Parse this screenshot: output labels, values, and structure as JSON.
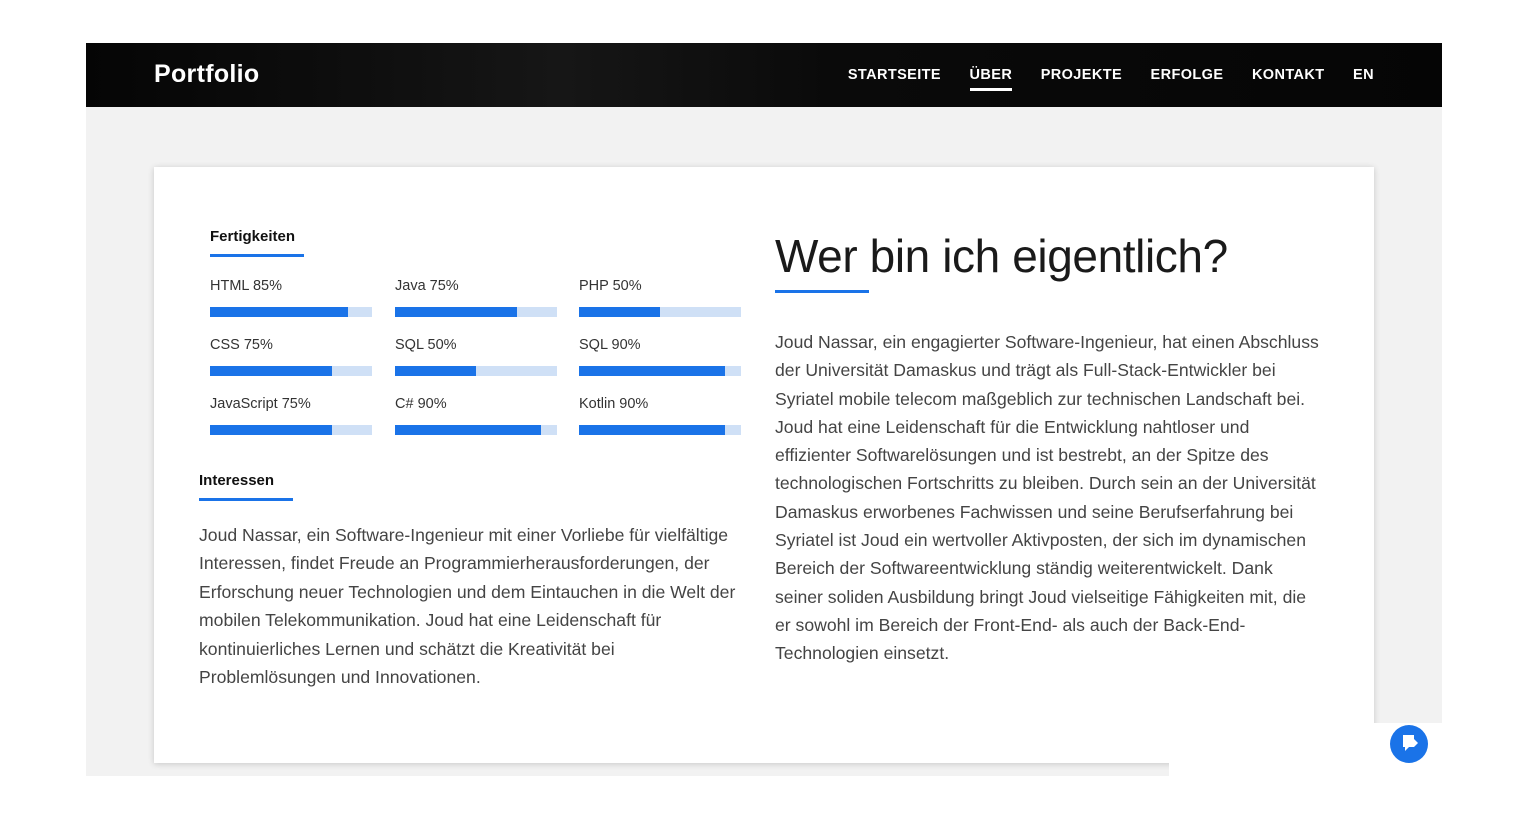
{
  "navbar": {
    "brand": "Portfolio",
    "links": [
      {
        "label": "STARTSEITE",
        "active": false
      },
      {
        "label": "ÜBER",
        "active": true
      },
      {
        "label": "PROJEKTE",
        "active": false
      },
      {
        "label": "ERFOLGE",
        "active": false
      },
      {
        "label": "KONTAKT",
        "active": false
      },
      {
        "label": "EN",
        "active": false
      }
    ]
  },
  "skills": {
    "title": "Fertigkeiten",
    "items": [
      {
        "label": "HTML 85%",
        "percent": 85
      },
      {
        "label": "Java 75%",
        "percent": 75
      },
      {
        "label": "PHP 50%",
        "percent": 50
      },
      {
        "label": "CSS 75%",
        "percent": 75
      },
      {
        "label": "SQL 50%",
        "percent": 50
      },
      {
        "label": "SQL 90%",
        "percent": 90
      },
      {
        "label": "JavaScript 75%",
        "percent": 75
      },
      {
        "label": "C# 90%",
        "percent": 90
      },
      {
        "label": "Kotlin 90%",
        "percent": 90
      }
    ]
  },
  "interests": {
    "title": "Interessen",
    "text": "Joud Nassar, ein Software-Ingenieur mit einer Vorliebe für vielfältige Interessen, findet Freude an Programmierherausforderungen, der Erforschung neuer Technologien und dem Eintauchen in die Welt der mobilen Telekommunikation. Joud hat eine Leidenschaft für kontinuierliches Lernen und schätzt die Kreativität bei Problemlösungen und Innovationen."
  },
  "about": {
    "heading": "Wer bin ich eigentlich?",
    "text": "Joud Nassar, ein engagierter Software-Ingenieur, hat einen Abschluss der Universität Damaskus und trägt als Full-Stack-Entwickler bei Syriatel mobile telecom maßgeblich zur technischen Landschaft bei. Joud hat eine Leidenschaft für die Entwicklung nahtloser und effizienter Softwarelösungen und ist bestrebt, an der Spitze des technologischen Fortschritts zu bleiben. Durch sein an der Universität Damaskus erworbenes Fachwissen und seine Berufserfahrung bei Syriatel ist Joud ein wertvoller Aktivposten, der sich im dynamischen Bereich der Softwareentwicklung ständig weiterentwickelt. Dank seiner soliden Ausbildung bringt Joud vielseitige Fähigkeiten mit, die er sowohl im Bereich der Front-End- als auch der Back-End-Technologien einsetzt."
  },
  "chat_widget": {
    "icon": "chat-icon"
  },
  "colors": {
    "accent": "#1a73e8",
    "bar_track": "#cfe0f6",
    "navbar_bg": "#0a0a0a",
    "page_bg": "#f2f2f2"
  }
}
